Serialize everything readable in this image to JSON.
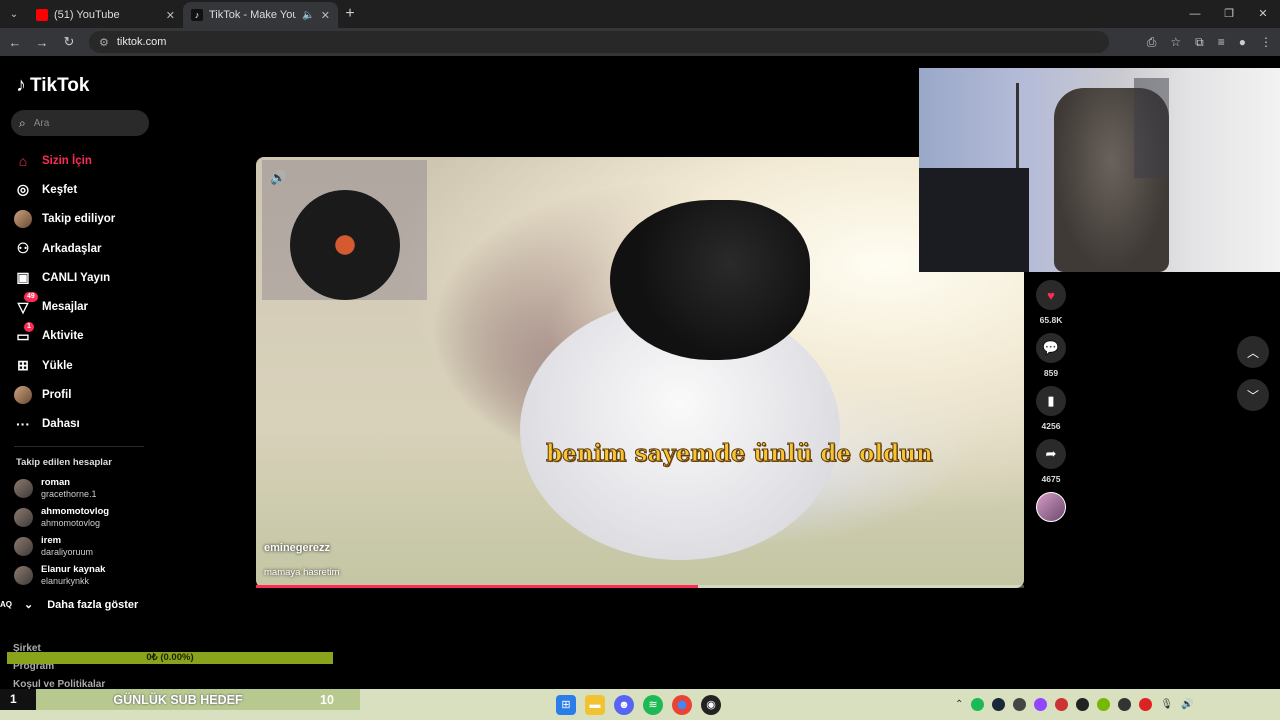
{
  "browser": {
    "tabs": [
      {
        "title": "(51) YouTube",
        "active": false
      },
      {
        "title": "TikTok - Make Your Day",
        "active": true
      }
    ],
    "url": "tiktok.com"
  },
  "sidebar": {
    "logo": "TikTok",
    "search_placeholder": "Ara",
    "nav": [
      {
        "label": "Sizin İçin",
        "icon": "home-icon"
      },
      {
        "label": "Keşfet",
        "icon": "compass-icon"
      },
      {
        "label": "Takip ediliyor",
        "icon": "following-avatar"
      },
      {
        "label": "Arkadaşlar",
        "icon": "friends-icon"
      },
      {
        "label": "CANLI Yayın",
        "icon": "live-icon"
      },
      {
        "label": "Mesajlar",
        "icon": "messages-icon",
        "badge": "49"
      },
      {
        "label": "Aktivite",
        "icon": "activity-icon",
        "badge": "1"
      },
      {
        "label": "Yükle",
        "icon": "upload-icon"
      },
      {
        "label": "Profil",
        "icon": "profile-avatar"
      },
      {
        "label": "Dahası",
        "icon": "more-icon"
      }
    ],
    "following_title": "Takip edilen hesaplar",
    "following": [
      {
        "name": "roman",
        "handle": "gracethorne.1"
      },
      {
        "name": "ahmomotovlog",
        "handle": "ahmomotovlog"
      },
      {
        "name": "irem",
        "handle": "daraliyoruum"
      },
      {
        "name": "Elanur kaynak",
        "handle": "elanurkynkk"
      }
    ],
    "show_more": "Daha fazla göster",
    "footer": [
      "Şirket",
      "Program",
      "Koşul ve Politikalar"
    ]
  },
  "video": {
    "caption": "benim sayemde ünlü de oldun",
    "author": "eminegerezz",
    "description": "mamaya hasretim",
    "progress": 0.576
  },
  "actions": {
    "likes": "65.8K",
    "comments": "859",
    "saves": "4256",
    "shares": "4675"
  },
  "overlay": {
    "goal_bar": "0₺ (0.00%)",
    "sub_goal_rank": "1",
    "sub_goal_label": "GÜNLÜK SUB HEDEF",
    "sub_goal_count": "10"
  }
}
